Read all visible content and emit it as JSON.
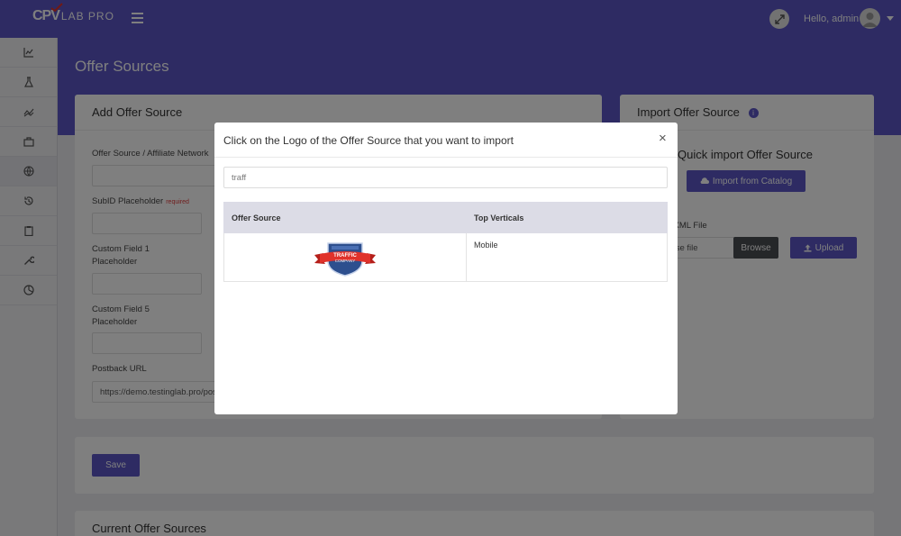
{
  "header": {
    "logo_main": "CPV",
    "logo_sub": "LAB PRO",
    "greeting": "Hello, admin"
  },
  "sidebar": {
    "items": [
      {
        "icon": "line-chart-icon"
      },
      {
        "icon": "flask-icon"
      },
      {
        "icon": "trend-icon"
      },
      {
        "icon": "briefcase-icon"
      },
      {
        "icon": "globe-icon"
      },
      {
        "icon": "history-icon"
      },
      {
        "icon": "clipboard-icon"
      },
      {
        "icon": "wrench-icon"
      },
      {
        "icon": "pie-icon"
      }
    ]
  },
  "page": {
    "title": "Offer Sources"
  },
  "add_form": {
    "title": "Add Offer Source",
    "offer_source_label": "Offer Source / Affiliate Network",
    "subid_label": "SubID Placeholder",
    "required_text": "required",
    "custom1_label": "Custom Field 1 Placeholder",
    "custom5_label": "Custom Field 5 Placeholder",
    "postback_label": "Postback URL",
    "postback_value": "https://demo.testinglab.pro/postback"
  },
  "import_card": {
    "title": "Import Offer Source",
    "quick_title": "Quick import Offer Source",
    "catalog_button": "Import from Catalog",
    "file_label": "Import XML File",
    "file_placeholder": "Choose file",
    "browse_button": "Browse",
    "upload_button": "Upload"
  },
  "save_button": "Save",
  "current_title": "Current Offer Sources",
  "modal": {
    "title": "Click on the Logo of the Offer Source that you want to import",
    "close": "×",
    "search_value": "traff",
    "columns": [
      "Offer Source",
      "Top Verticals"
    ],
    "rows": [
      {
        "logo_text_1": "TRAFFIC",
        "logo_text_2": "COMPANY",
        "verticals": "Mobile"
      }
    ]
  },
  "colors": {
    "primary": "#5c57c6",
    "ribbon": "#e0322b",
    "shield": "#2d4f8e"
  }
}
